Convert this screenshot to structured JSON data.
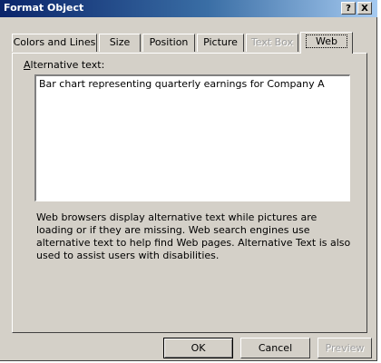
{
  "window": {
    "title": "Format Object",
    "help_glyph": "?",
    "close_glyph": "X"
  },
  "tabs": [
    {
      "label": "Colors and Lines",
      "state": "normal"
    },
    {
      "label": "Size",
      "state": "normal"
    },
    {
      "label": "Position",
      "state": "normal"
    },
    {
      "label": "Picture",
      "state": "normal"
    },
    {
      "label": "Text Box",
      "state": "disabled"
    },
    {
      "label": "Web",
      "state": "selected"
    }
  ],
  "web_tab": {
    "alt_label_accel": "A",
    "alt_label_rest": "lternative text:",
    "alt_text_value": "Bar chart representing quarterly earnings for Company A",
    "help_text": "Web browsers display alternative text while pictures are loading or if they are missing.   Web search engines use alternative text to help find Web pages.  Alternative Text is also used to assist users with disabilities."
  },
  "buttons": {
    "ok": "OK",
    "cancel": "Cancel",
    "preview": "Preview"
  },
  "colors": {
    "title_bar": "#0a246a",
    "dialog_face": "#d4d0c8"
  }
}
